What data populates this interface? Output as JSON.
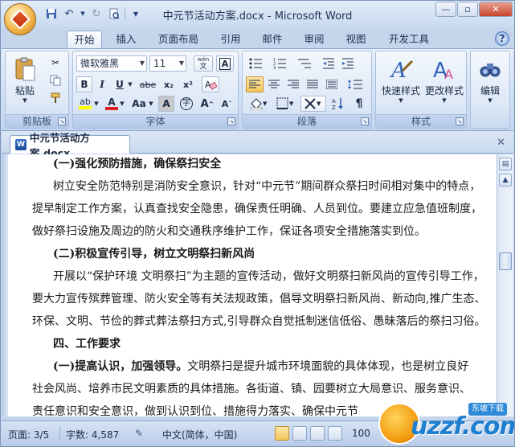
{
  "window": {
    "title": "中元节活动方案.docx - Microsoft Word"
  },
  "tabs": [
    "开始",
    "插入",
    "页面布局",
    "引用",
    "邮件",
    "审阅",
    "视图",
    "开发工具"
  ],
  "ribbon": {
    "clipboard": {
      "label": "剪贴板",
      "paste": "粘贴"
    },
    "font": {
      "label": "字体",
      "font_name": "微软雅黑",
      "font_size": "11",
      "bold": "B",
      "italic": "I",
      "underline": "U",
      "strike": "abe",
      "subscript": "x₂",
      "superscript": "x²",
      "case": "Aa",
      "grow": "A",
      "shrink": "A",
      "wen": "wén",
      "char_border": "A",
      "char_shading": "A",
      "enclose": "字"
    },
    "paragraph": {
      "label": "段落"
    },
    "styles": {
      "label": "样式",
      "quick_styles": "快速样式",
      "change_styles": "更改样式"
    },
    "editing": {
      "label": "编辑"
    }
  },
  "document_tab": {
    "name": "中元节活动方案.docx"
  },
  "document": {
    "lines": [
      {
        "text": "(一)强化预防措施，确保祭扫安全",
        "bold": true,
        "indent": true
      },
      {
        "text": "树立安全防范特别是消防安全意识，针对“中元节”期间群众祭扫时间相对集中的特点，",
        "bold": false,
        "indent": true
      },
      {
        "text": "提早制定工作方案，认真查找安全隐患，确保责任明确、人员到位。要建立应急值班制度，",
        "bold": false,
        "indent": false
      },
      {
        "text": "做好祭扫设施及周边的防火和交通秩序维护工作，保证各项安全措施落实到位。",
        "bold": false,
        "indent": false
      },
      {
        "text": "(二)积极宣传引导，树立文明祭扫新风尚",
        "bold": true,
        "indent": true
      },
      {
        "text": "开展以“保护环境  文明祭扫”为主题的宣传活动，做好文明祭扫新风尚的宣传引导工作，",
        "bold": false,
        "indent": true
      },
      {
        "text": "要大力宣传殡葬管理、防火安全等有关法规政策，倡导文明祭扫新风尚、新动向,推广生态、",
        "bold": false,
        "indent": false
      },
      {
        "text": "环保、文明、节俭的葬式葬法祭扫方式,引导群众自觉抵制迷信低俗、愚昧落后的祭扫习俗。",
        "bold": false,
        "indent": false
      },
      {
        "text": "四、工作要求",
        "bold": true,
        "indent": true
      },
      {
        "bold_prefix": "(一)提高认识，加强领导。",
        "text": "文明祭扫是提升城市环境面貌的具体体现，也是树立良好",
        "indent": true
      },
      {
        "text": "社会风尚、培养市民文明素质的具体措施。各街道、镇、园要树立大局意识、服务意识、",
        "bold": false,
        "indent": false
      },
      {
        "text": "责任意识和安全意识，做到认识到位、措施得力落实、确保中元节",
        "bold": false,
        "indent": false
      }
    ]
  },
  "status": {
    "page": "页面: 3/5",
    "words": "字数: 4,587",
    "language": "中文(简体，中国)",
    "zoom": "100"
  },
  "watermark": {
    "text": "uzzf.com",
    "badge": "东坡下载"
  },
  "colors": {
    "ribbon_bg": "#cddcf1",
    "highlight": "#ffff00",
    "font_color": "#e02020",
    "accent": "#1e7fd0"
  }
}
